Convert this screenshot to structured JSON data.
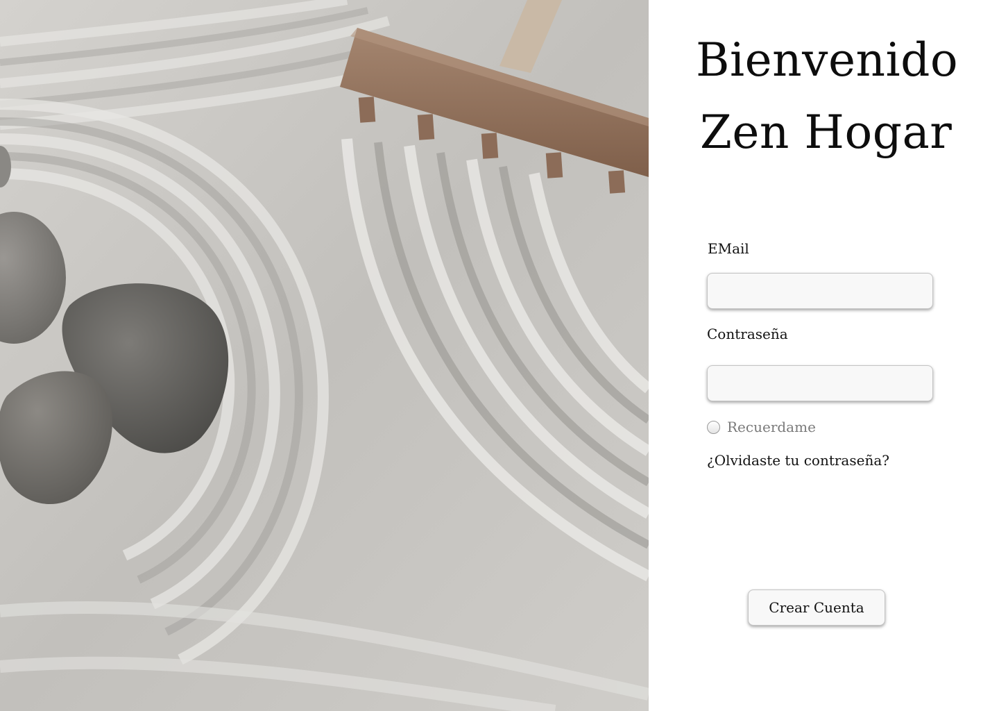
{
  "hero": {
    "image": "zen-garden-sand-rake-stones-photo"
  },
  "login": {
    "title_line1": "Bienvenido",
    "title_line2": "Zen Hogar",
    "email_label": "EMail",
    "email_value": "",
    "password_label": "Contraseña",
    "password_value": "",
    "remember_label": "Recuerdame",
    "remember_checked": false,
    "forgot_link": "¿Olvidaste tu contraseña?",
    "create_account_button": "Crear Cuenta"
  }
}
